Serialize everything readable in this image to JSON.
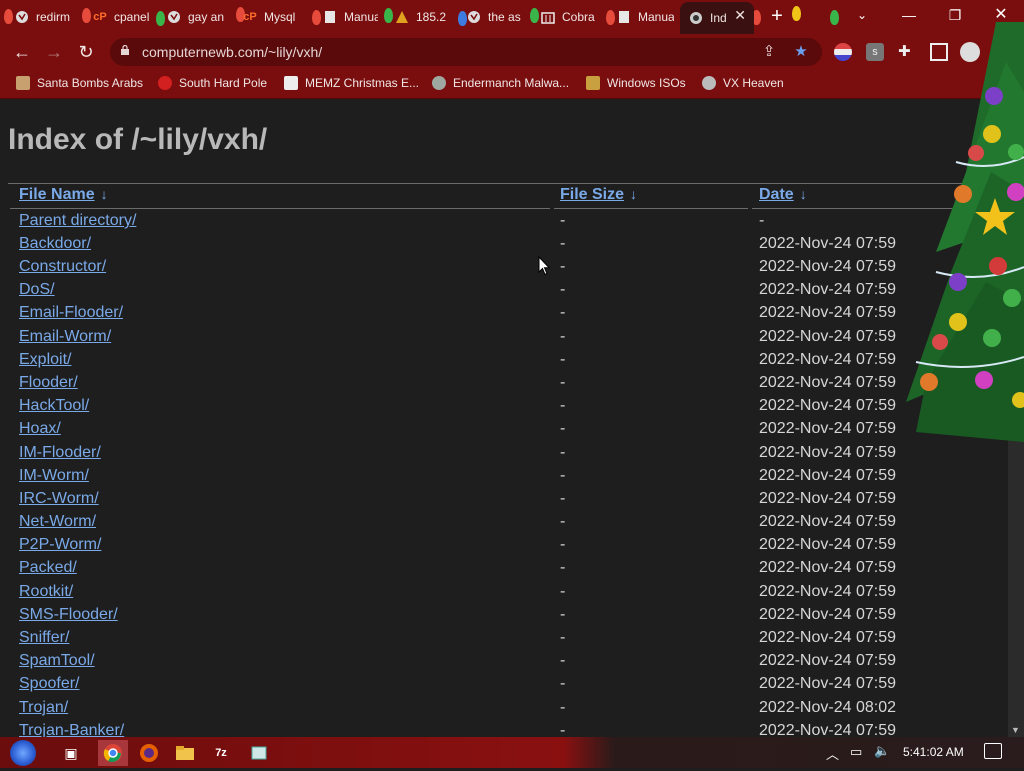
{
  "browser": {
    "tabs": [
      {
        "label": "redirm",
        "favicon": "globe-icon",
        "active": false
      },
      {
        "label": "cpanel",
        "favicon": "cpanel-icon",
        "active": false
      },
      {
        "label": "gay an",
        "favicon": "globe-icon",
        "active": false
      },
      {
        "label": "Mysql",
        "favicon": "cpanel-icon",
        "active": false
      },
      {
        "label": "Manua",
        "favicon": "doc-icon",
        "active": false
      },
      {
        "label": "185.2",
        "favicon": "warning-icon",
        "active": false
      },
      {
        "label": "the as",
        "favicon": "globe-icon",
        "active": false
      },
      {
        "label": "Cobra",
        "favicon": "building-icon",
        "active": false
      },
      {
        "label": "Manua",
        "favicon": "doc-icon",
        "active": false
      },
      {
        "label": "Ind",
        "favicon": "vx-icon",
        "active": true
      }
    ],
    "url": "computernewb.com/~lily/vxh/",
    "bookmarks": [
      {
        "label": "Santa Bombs Arabs",
        "icon": "figure-icon"
      },
      {
        "label": "South Hard Pole",
        "icon": "maple-leaf-icon"
      },
      {
        "label": "MEMZ Christmas E...",
        "icon": "page-icon"
      },
      {
        "label": "Endermanch Malwa...",
        "icon": "enderman-icon"
      },
      {
        "label": "Windows ISOs",
        "icon": "figure-icon"
      },
      {
        "label": "VX Heaven",
        "icon": "vx-icon"
      }
    ]
  },
  "page": {
    "title": "Index of /~lily/vxh/",
    "columns": [
      {
        "label": "File Name",
        "sort": "↓"
      },
      {
        "label": "File Size",
        "sort": "↓"
      },
      {
        "label": "Date",
        "sort": "↓"
      }
    ],
    "rows": [
      {
        "name": "Parent directory/",
        "size": "-",
        "date": "-"
      },
      {
        "name": "Backdoor/",
        "size": "-",
        "date": "2022-Nov-24 07:59"
      },
      {
        "name": "Constructor/",
        "size": "-",
        "date": "2022-Nov-24 07:59"
      },
      {
        "name": "DoS/",
        "size": "-",
        "date": "2022-Nov-24 07:59"
      },
      {
        "name": "Email-Flooder/",
        "size": "-",
        "date": "2022-Nov-24 07:59"
      },
      {
        "name": "Email-Worm/",
        "size": "-",
        "date": "2022-Nov-24 07:59"
      },
      {
        "name": "Exploit/",
        "size": "-",
        "date": "2022-Nov-24 07:59"
      },
      {
        "name": "Flooder/",
        "size": "-",
        "date": "2022-Nov-24 07:59"
      },
      {
        "name": "HackTool/",
        "size": "-",
        "date": "2022-Nov-24 07:59"
      },
      {
        "name": "Hoax/",
        "size": "-",
        "date": "2022-Nov-24 07:59"
      },
      {
        "name": "IM-Flooder/",
        "size": "-",
        "date": "2022-Nov-24 07:59"
      },
      {
        "name": "IM-Worm/",
        "size": "-",
        "date": "2022-Nov-24 07:59"
      },
      {
        "name": "IRC-Worm/",
        "size": "-",
        "date": "2022-Nov-24 07:59"
      },
      {
        "name": "Net-Worm/",
        "size": "-",
        "date": "2022-Nov-24 07:59"
      },
      {
        "name": "P2P-Worm/",
        "size": "-",
        "date": "2022-Nov-24 07:59"
      },
      {
        "name": "Packed/",
        "size": "-",
        "date": "2022-Nov-24 07:59"
      },
      {
        "name": "Rootkit/",
        "size": "-",
        "date": "2022-Nov-24 07:59"
      },
      {
        "name": "SMS-Flooder/",
        "size": "-",
        "date": "2022-Nov-24 07:59"
      },
      {
        "name": "Sniffer/",
        "size": "-",
        "date": "2022-Nov-24 07:59"
      },
      {
        "name": "SpamTool/",
        "size": "-",
        "date": "2022-Nov-24 07:59"
      },
      {
        "name": "Spoofer/",
        "size": "-",
        "date": "2022-Nov-24 07:59"
      },
      {
        "name": "Trojan/",
        "size": "-",
        "date": "2022-Nov-24 08:02"
      },
      {
        "name": "Trojan-Banker/",
        "size": "-",
        "date": "2022-Nov-24 07:59"
      }
    ]
  },
  "taskbar": {
    "clock": "5:41:02 AM",
    "apps": [
      "start-orb-icon",
      "task-view-icon",
      "chrome-icon",
      "firefox-icon",
      "file-explorer-icon",
      "7zip-icon",
      "notepad-app-icon"
    ],
    "tray": [
      "chevron-up-icon",
      "network-icon",
      "volume-icon",
      "notification-icon"
    ]
  },
  "colors": {
    "chrome_red": "#7a0e0e",
    "omnibox": "#5a0a0a",
    "page_bg": "#1e1e1e",
    "link": "#7aa9e8",
    "title_text": "#b8b8b8"
  }
}
